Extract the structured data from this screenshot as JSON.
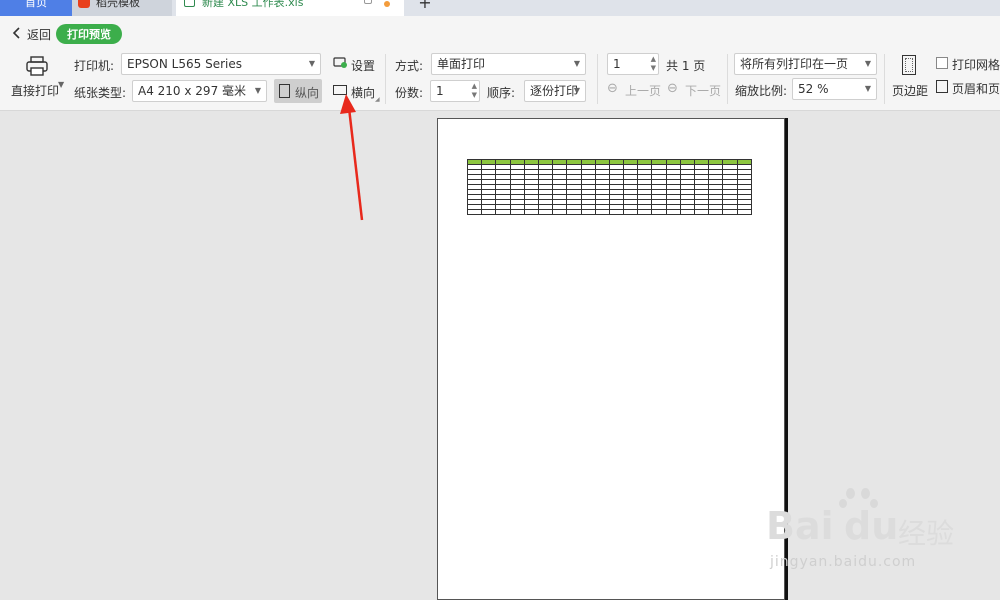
{
  "tabs": {
    "home": "首页",
    "daoke": "稻壳模板",
    "file": "新建 XLS 工作表.xls",
    "add": "+"
  },
  "header": {
    "back": "返回",
    "mode": "打印预览"
  },
  "printer": {
    "direct_print": "直接打印",
    "printer_label": "打印机:",
    "printer_value": "EPSON L565 Series",
    "paper_label": "纸张类型:",
    "paper_value": "A4 210 x 297 毫米",
    "portrait": "纵向",
    "landscape": "横向",
    "settings": "设置"
  },
  "mode": {
    "method_label": "方式:",
    "method_value": "单面打印",
    "copies_label": "份数:",
    "copies_value": "1",
    "order_label": "顺序:",
    "order_value": "逐份打印"
  },
  "paging": {
    "page_value": "1",
    "total": "共 1 页",
    "prev": "上一页",
    "next": "下一页"
  },
  "scaling": {
    "fit_value": "将所有列打印在一页",
    "zoom_label": "缩放比例:",
    "zoom_value": "52 %"
  },
  "page_opts": {
    "margins": "页边距",
    "gridlines": "打印网格线",
    "header_footer": "页眉和页脚"
  },
  "watermark": {
    "brand": "Bai",
    "brand2": "du",
    "cn": "经验",
    "url": "jingyan.baidu.com"
  },
  "colors": {
    "accent": "#3cae4b",
    "tab_home": "#4f7fe6",
    "arrow": "#e8291c",
    "sheet_header": "#8cc63f"
  }
}
